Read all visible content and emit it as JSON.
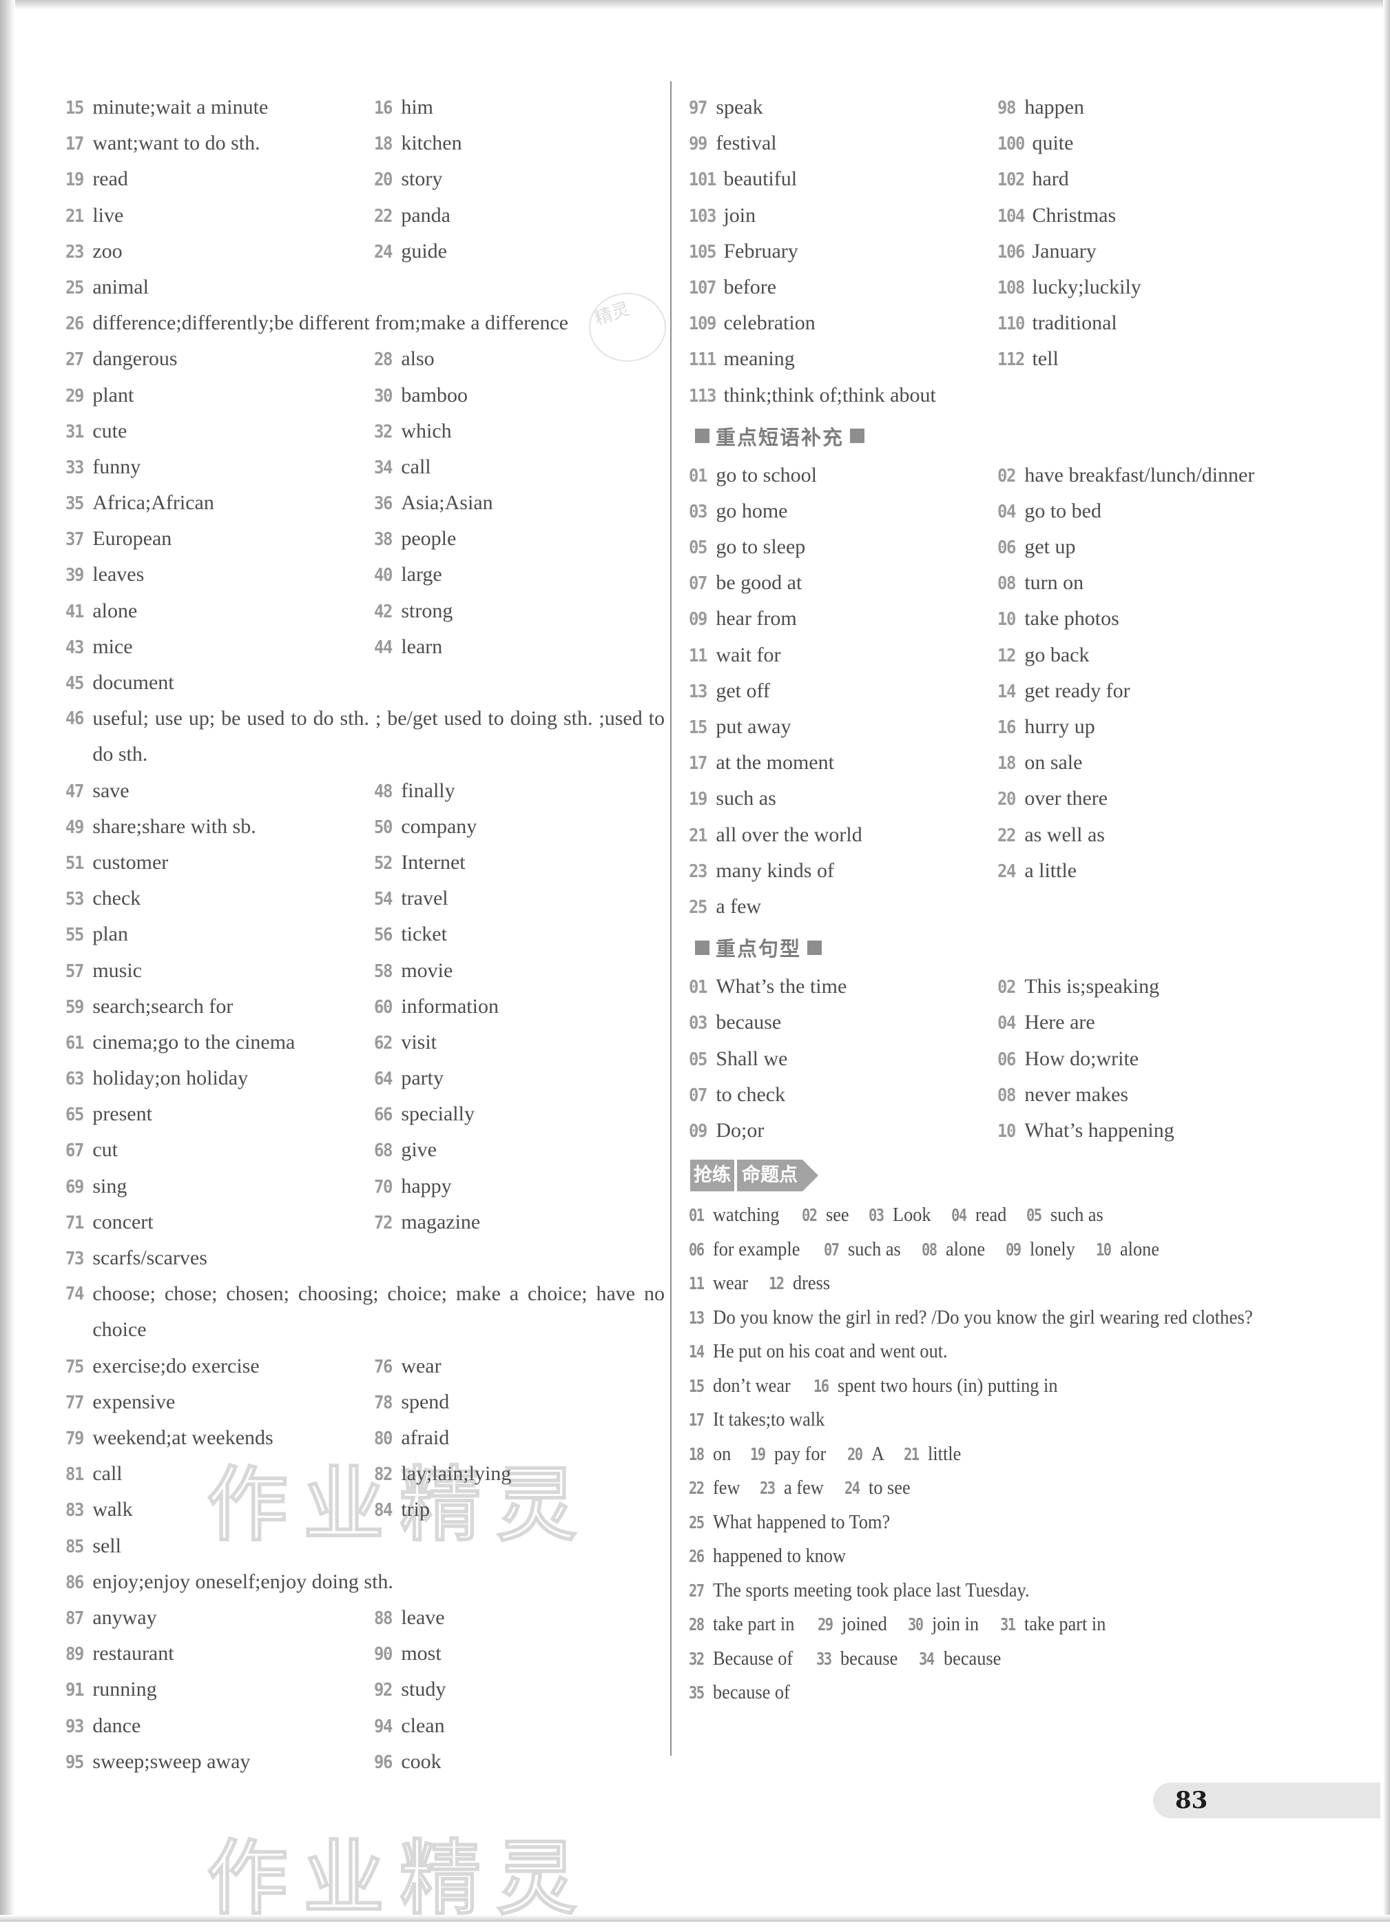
{
  "page": {
    "page_number": "83",
    "watermark": "作业精灵",
    "stamp_text": "精灵"
  },
  "left_column": {
    "words": [
      {
        "num": "15",
        "text": "minute;wait a minute",
        "num2": "16",
        "text2": "him"
      },
      {
        "num": "17",
        "text": "want;want to do sth.",
        "num2": "18",
        "text2": "kitchen"
      },
      {
        "num": "19",
        "text": "read",
        "num2": "20",
        "text2": "story"
      },
      {
        "num": "21",
        "text": "live",
        "num2": "22",
        "text2": "panda"
      },
      {
        "num": "23",
        "text": "zoo",
        "num2": "24",
        "text2": "guide"
      },
      {
        "num": "25",
        "text": "animal",
        "num2": "",
        "text2": ""
      },
      {
        "num": "26",
        "text": "difference;differently;be different from;make a difference",
        "full": true
      },
      {
        "num": "27",
        "text": "dangerous",
        "num2": "28",
        "text2": "also"
      },
      {
        "num": "29",
        "text": "plant",
        "num2": "30",
        "text2": "bamboo"
      },
      {
        "num": "31",
        "text": "cute",
        "num2": "32",
        "text2": "which"
      },
      {
        "num": "33",
        "text": "funny",
        "num2": "34",
        "text2": "call"
      },
      {
        "num": "35",
        "text": "Africa;African",
        "num2": "36",
        "text2": "Asia;Asian"
      },
      {
        "num": "37",
        "text": "European",
        "num2": "38",
        "text2": "people"
      },
      {
        "num": "39",
        "text": "leaves",
        "num2": "40",
        "text2": "large"
      },
      {
        "num": "41",
        "text": "alone",
        "num2": "42",
        "text2": "strong"
      },
      {
        "num": "43",
        "text": "mice",
        "num2": "44",
        "text2": "learn"
      },
      {
        "num": "45",
        "text": "document",
        "num2": "",
        "text2": ""
      },
      {
        "num": "46",
        "text": "useful; use up; be used to do sth. ; be/get used to doing sth. ;used to do sth.",
        "wrap": true
      },
      {
        "num": "47",
        "text": "save",
        "num2": "48",
        "text2": "finally"
      },
      {
        "num": "49",
        "text": "share;share with sb.",
        "num2": "50",
        "text2": "company"
      },
      {
        "num": "51",
        "text": "customer",
        "num2": "52",
        "text2": "Internet"
      },
      {
        "num": "53",
        "text": "check",
        "num2": "54",
        "text2": "travel"
      },
      {
        "num": "55",
        "text": "plan",
        "num2": "56",
        "text2": "ticket"
      },
      {
        "num": "57",
        "text": "music",
        "num2": "58",
        "text2": "movie"
      },
      {
        "num": "59",
        "text": "search;search for",
        "num2": "60",
        "text2": "information"
      },
      {
        "num": "61",
        "text": "cinema;go to the cinema",
        "num2": "62",
        "text2": "visit"
      },
      {
        "num": "63",
        "text": "holiday;on holiday",
        "num2": "64",
        "text2": "party"
      },
      {
        "num": "65",
        "text": "present",
        "num2": "66",
        "text2": "specially"
      },
      {
        "num": "67",
        "text": "cut",
        "num2": "68",
        "text2": "give"
      },
      {
        "num": "69",
        "text": "sing",
        "num2": "70",
        "text2": "happy"
      },
      {
        "num": "71",
        "text": "concert",
        "num2": "72",
        "text2": "magazine"
      },
      {
        "num": "73",
        "text": "scarfs/scarves",
        "num2": "",
        "text2": ""
      },
      {
        "num": "74",
        "text": "choose; chose; chosen; choosing; choice; make a choice; have no choice",
        "wrap": true
      },
      {
        "num": "75",
        "text": "exercise;do exercise",
        "num2": "76",
        "text2": "wear"
      },
      {
        "num": "77",
        "text": "expensive",
        "num2": "78",
        "text2": "spend"
      },
      {
        "num": "79",
        "text": "weekend;at weekends",
        "num2": "80",
        "text2": "afraid"
      },
      {
        "num": "81",
        "text": "call",
        "num2": "82",
        "text2": "lay;lain;lying"
      },
      {
        "num": "83",
        "text": "walk",
        "num2": "84",
        "text2": "trip"
      },
      {
        "num": "85",
        "text": "sell",
        "num2": "",
        "text2": ""
      },
      {
        "num": "86",
        "text": "enjoy;enjoy oneself;enjoy doing sth.",
        "full": true
      },
      {
        "num": "87",
        "text": "anyway",
        "num2": "88",
        "text2": "leave"
      },
      {
        "num": "89",
        "text": "restaurant",
        "num2": "90",
        "text2": "most"
      },
      {
        "num": "91",
        "text": "running",
        "num2": "92",
        "text2": "study"
      },
      {
        "num": "93",
        "text": "dance",
        "num2": "94",
        "text2": "clean"
      },
      {
        "num": "95",
        "text": "sweep;sweep away",
        "num2": "96",
        "text2": "cook"
      }
    ]
  },
  "right_column": {
    "words": [
      {
        "num": "97",
        "text": "speak",
        "num2": "98",
        "text2": "happen"
      },
      {
        "num": "99",
        "text": "festival",
        "num2": "100",
        "text2": "quite"
      },
      {
        "num": "101",
        "text": "beautiful",
        "num2": "102",
        "text2": "hard"
      },
      {
        "num": "103",
        "text": "join",
        "num2": "104",
        "text2": "Christmas"
      },
      {
        "num": "105",
        "text": "February",
        "num2": "106",
        "text2": "January"
      },
      {
        "num": "107",
        "text": "before",
        "num2": "108",
        "text2": "lucky;luckily"
      },
      {
        "num": "109",
        "text": "celebration",
        "num2": "110",
        "text2": "traditional"
      },
      {
        "num": "111",
        "text": "meaning",
        "num2": "112",
        "text2": "tell"
      },
      {
        "num": "113",
        "text": "think;think of;think about",
        "full": true
      }
    ],
    "phrases_section": {
      "title": "重点短语补充",
      "items": [
        {
          "num": "01",
          "text": "go to school",
          "num2": "02",
          "text2": "have breakfast/lunch/dinner"
        },
        {
          "num": "03",
          "text": "go home",
          "num2": "04",
          "text2": "go to bed"
        },
        {
          "num": "05",
          "text": "go to sleep",
          "num2": "06",
          "text2": "get up"
        },
        {
          "num": "07",
          "text": "be good at",
          "num2": "08",
          "text2": "turn on"
        },
        {
          "num": "09",
          "text": "hear from",
          "num2": "10",
          "text2": "take photos"
        },
        {
          "num": "11",
          "text": "wait for",
          "num2": "12",
          "text2": "go back"
        },
        {
          "num": "13",
          "text": "get off",
          "num2": "14",
          "text2": "get ready for"
        },
        {
          "num": "15",
          "text": "put away",
          "num2": "16",
          "text2": "hurry up"
        },
        {
          "num": "17",
          "text": "at the moment",
          "num2": "18",
          "text2": "on sale"
        },
        {
          "num": "19",
          "text": "such as",
          "num2": "20",
          "text2": "over there"
        },
        {
          "num": "21",
          "text": "all over the world",
          "num2": "22",
          "text2": "as well as"
        },
        {
          "num": "23",
          "text": "many kinds of",
          "num2": "24",
          "text2": "a little"
        },
        {
          "num": "25",
          "text": "a few",
          "num2": "",
          "text2": ""
        }
      ]
    },
    "patterns_section": {
      "title": "重点句型",
      "items": [
        {
          "num": "01",
          "text": "What’s the time",
          "num2": "02",
          "text2": "This is;speaking"
        },
        {
          "num": "03",
          "text": "because",
          "num2": "04",
          "text2": "Here are"
        },
        {
          "num": "05",
          "text": "Shall we",
          "num2": "06",
          "text2": "How do;write"
        },
        {
          "num": "07",
          "text": "to check",
          "num2": "08",
          "text2": "never makes"
        },
        {
          "num": "09",
          "text": "Do;or",
          "num2": "10",
          "text2": "What’s happening"
        }
      ]
    },
    "drill_section": {
      "badge_seg1": "抢练",
      "badge_seg2": "命题点",
      "lines": [
        {
          "items": [
            {
              "num": "01",
              "text": "watching"
            },
            {
              "num": "02",
              "text": "see"
            },
            {
              "num": "03",
              "text": "Look"
            },
            {
              "num": "04",
              "text": "read"
            },
            {
              "num": "05",
              "text": "such as"
            }
          ]
        },
        {
          "items": [
            {
              "num": "06",
              "text": "for example"
            },
            {
              "num": "07",
              "text": "such as"
            },
            {
              "num": "08",
              "text": "alone"
            },
            {
              "num": "09",
              "text": "lonely"
            },
            {
              "num": "10",
              "text": "alone"
            }
          ]
        },
        {
          "items": [
            {
              "num": "11",
              "text": "wear"
            },
            {
              "num": "12",
              "text": "dress"
            }
          ]
        },
        {
          "num": "13",
          "wrap": true,
          "text": "Do you know the girl in red? /Do you know the girl wearing red clothes?"
        },
        {
          "items": [
            {
              "num": "14",
              "text": "He put on his coat and went out."
            }
          ]
        },
        {
          "items": [
            {
              "num": "15",
              "text": "don’t wear"
            },
            {
              "num": "16",
              "text": "spent two hours (in) putting in"
            }
          ]
        },
        {
          "items": [
            {
              "num": "17",
              "text": "It takes;to walk"
            }
          ]
        },
        {
          "items": [
            {
              "num": "18",
              "text": "on"
            },
            {
              "num": "19",
              "text": "pay for"
            },
            {
              "num": "20",
              "text": "A"
            },
            {
              "num": "21",
              "text": "little"
            }
          ]
        },
        {
          "items": [
            {
              "num": "22",
              "text": "few"
            },
            {
              "num": "23",
              "text": "a few"
            },
            {
              "num": "24",
              "text": "to see"
            }
          ]
        },
        {
          "items": [
            {
              "num": "25",
              "text": "What happened to Tom?"
            }
          ]
        },
        {
          "items": [
            {
              "num": "26",
              "text": "happened to know"
            }
          ]
        },
        {
          "items": [
            {
              "num": "27",
              "text": "The sports meeting took place last Tuesday."
            }
          ]
        },
        {
          "items": [
            {
              "num": "28",
              "text": "take part in"
            },
            {
              "num": "29",
              "text": "joined"
            },
            {
              "num": "30",
              "text": "join in"
            },
            {
              "num": "31",
              "text": "take part in"
            }
          ]
        },
        {
          "items": [
            {
              "num": "32",
              "text": "Because of"
            },
            {
              "num": "33",
              "text": "because"
            },
            {
              "num": "34",
              "text": "because"
            }
          ]
        },
        {
          "items": [
            {
              "num": "35",
              "text": "because of"
            }
          ]
        }
      ]
    }
  }
}
